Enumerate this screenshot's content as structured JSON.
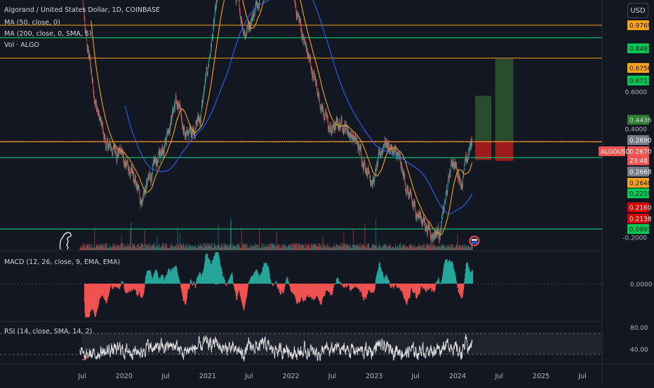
{
  "header": {
    "symbol_title": "Algorand / United States Dollar, 1D, COINBASE",
    "indicators": [
      "MA (50, close, 0)",
      "MA (200, close, 0, SMA, 5)",
      "Vol · ALGO"
    ],
    "currency_button": "USD"
  },
  "colors": {
    "background": "#131722",
    "candle_up": "#26a69a",
    "candle_down": "#ef5350",
    "ma50": "#f7a21b",
    "ma200": "#2962ff",
    "hline_orange": "#f7a21b",
    "hline_green": "#00e676",
    "macd_pos": "#26a69a",
    "macd_neg": "#ef5350",
    "rsi_line": "#e0e0e0"
  },
  "price_scale": {
    "tick_labels": [
      "0.6000",
      "0.4000",
      "-0.2000"
    ],
    "badges": [
      {
        "text": "0.9769",
        "bg": "#f7a21b",
        "fg": "#131722"
      },
      {
        "text": "0.8493",
        "bg": "#00c853",
        "fg": "#131722"
      },
      {
        "text": "0.6756",
        "bg": "#f7a21b",
        "fg": "#131722"
      },
      {
        "text": "0.6713",
        "bg": "#00c853",
        "fg": "#131722"
      },
      {
        "text": "0.4436",
        "bg": "#2e7d32",
        "fg": "#d1d4dc"
      },
      {
        "text": "0.2690",
        "bg": "#787b86",
        "fg": "#ffffff"
      },
      {
        "text": "0.2670",
        "bg": "#ef5350",
        "fg": "#ffffff"
      },
      {
        "text": "23:48",
        "bg": "#ef5350",
        "fg": "#ffffff"
      },
      {
        "text": "0.2668",
        "bg": "#787b86",
        "fg": "#ffffff"
      },
      {
        "text": "0.2648",
        "bg": "#f7a21b",
        "fg": "#131722"
      },
      {
        "text": "0.2219",
        "bg": "#00c853",
        "fg": "#131722"
      },
      {
        "text": "0.2160",
        "bg": "#d50000",
        "fg": "#ffffff"
      },
      {
        "text": "0.2138",
        "bg": "#d50000",
        "fg": "#ffffff"
      },
      {
        "text": "0.0997",
        "bg": "#00c853",
        "fg": "#131722"
      }
    ],
    "symbol_badge": "ALGOUSD"
  },
  "macd": {
    "title": "MACD (12, 26, close, 9, EMA, EMA)",
    "zero_label": "0.0000"
  },
  "rsi": {
    "title": "RSI (14, close, SMA, 14, 2)",
    "levels": [
      "80.00",
      "40.00"
    ]
  },
  "time_axis": {
    "labels": [
      "Jul",
      "2020",
      "Jul",
      "2021",
      "Jul",
      "2022",
      "Jul",
      "2023",
      "Jul",
      "2024",
      "Jul",
      "2025",
      "Jul"
    ]
  },
  "chart_data": {
    "type": "candlestick",
    "title": "Algorand / United States Dollar, 1D, COINBASE",
    "x_range": [
      "2019-06",
      "2025-08"
    ],
    "price_anchor_points": [
      {
        "date": "2019-06-20",
        "price": 2.0
      },
      {
        "date": "2019-07-15",
        "price": 0.9
      },
      {
        "date": "2019-09-01",
        "price": 0.4
      },
      {
        "date": "2019-10-15",
        "price": 0.25
      },
      {
        "date": "2019-12-15",
        "price": 0.24
      },
      {
        "date": "2020-03-15",
        "price": 0.14
      },
      {
        "date": "2020-06-01",
        "price": 0.22
      },
      {
        "date": "2020-08-15",
        "price": 0.42
      },
      {
        "date": "2020-10-01",
        "price": 0.28
      },
      {
        "date": "2020-12-01",
        "price": 0.35
      },
      {
        "date": "2021-02-15",
        "price": 1.3
      },
      {
        "date": "2021-04-15",
        "price": 1.6
      },
      {
        "date": "2021-06-15",
        "price": 0.9
      },
      {
        "date": "2021-08-01",
        "price": 1.2
      },
      {
        "date": "2021-09-15",
        "price": 2.0
      },
      {
        "date": "2021-11-15",
        "price": 1.8
      },
      {
        "date": "2022-01-01",
        "price": 1.5
      },
      {
        "date": "2022-03-01",
        "price": 0.8
      },
      {
        "date": "2022-05-15",
        "price": 0.4
      },
      {
        "date": "2022-06-20",
        "price": 0.3
      },
      {
        "date": "2022-08-15",
        "price": 0.33
      },
      {
        "date": "2022-10-01",
        "price": 0.28
      },
      {
        "date": "2022-12-30",
        "price": 0.17
      },
      {
        "date": "2023-02-15",
        "price": 0.27
      },
      {
        "date": "2023-04-15",
        "price": 0.22
      },
      {
        "date": "2023-06-15",
        "price": 0.13
      },
      {
        "date": "2023-09-15",
        "price": 0.095
      },
      {
        "date": "2023-10-20",
        "price": 0.1
      },
      {
        "date": "2023-12-10",
        "price": 0.22
      },
      {
        "date": "2024-01-20",
        "price": 0.17
      },
      {
        "date": "2024-03-05",
        "price": 0.267
      }
    ],
    "horizontal_levels": [
      {
        "price": 0.9769,
        "color": "orange"
      },
      {
        "price": 0.8493,
        "color": "green"
      },
      {
        "price": 0.6756,
        "color": "orange"
      },
      {
        "price": 0.2648,
        "color": "orange"
      },
      {
        "price": 0.2219,
        "color": "green"
      },
      {
        "price": 0.0997,
        "color": "green"
      }
    ],
    "long_positions": [
      {
        "entry": 0.267,
        "stop": 0.216,
        "target": 0.4436
      },
      {
        "entry": 0.267,
        "stop": 0.2138,
        "target": 0.6713
      }
    ],
    "last_price": 0.267,
    "rsi_levels": [
      80,
      40
    ]
  }
}
